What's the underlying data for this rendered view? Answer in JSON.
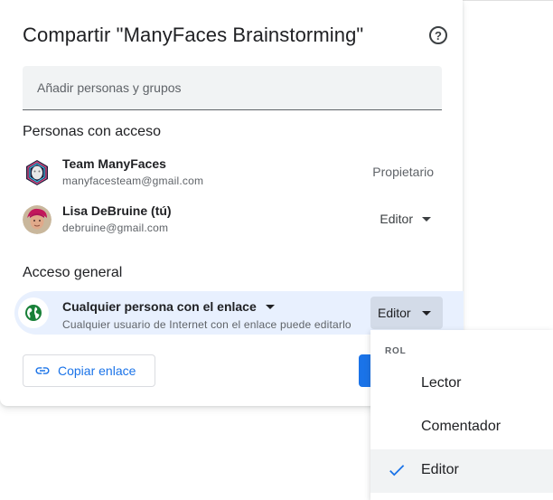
{
  "dialog": {
    "title": "Compartir \"ManyFaces Brainstorming\"",
    "help_icon": "help-circle-icon"
  },
  "add_people": {
    "placeholder": "Añadir personas y grupos"
  },
  "people_section": {
    "title": "Personas con acceso",
    "people": [
      {
        "name": "Team ManyFaces",
        "email": "manyfacesteam@gmail.com",
        "role": "Propietario"
      },
      {
        "name": "Lisa DeBruine (tú)",
        "email": "debruine@gmail.com",
        "role": "Editor"
      }
    ]
  },
  "general_access": {
    "title": "Acceso general",
    "link_scope": "Cualquier persona con el enlace",
    "description": "Cualquier usuario de Internet con el enlace puede editarlo",
    "role": "Editor",
    "icon": "globe-icon"
  },
  "copy_link": {
    "label": "Copiar enlace",
    "icon": "link-icon"
  },
  "role_menu": {
    "header": "ROL",
    "items": [
      {
        "label": "Lector",
        "selected": false
      },
      {
        "label": "Comentador",
        "selected": false
      },
      {
        "label": "Editor",
        "selected": true
      }
    ]
  },
  "colors": {
    "accent": "#1a73e8",
    "highlight_row": "#e8f0fe",
    "globe_green": "#188038"
  }
}
